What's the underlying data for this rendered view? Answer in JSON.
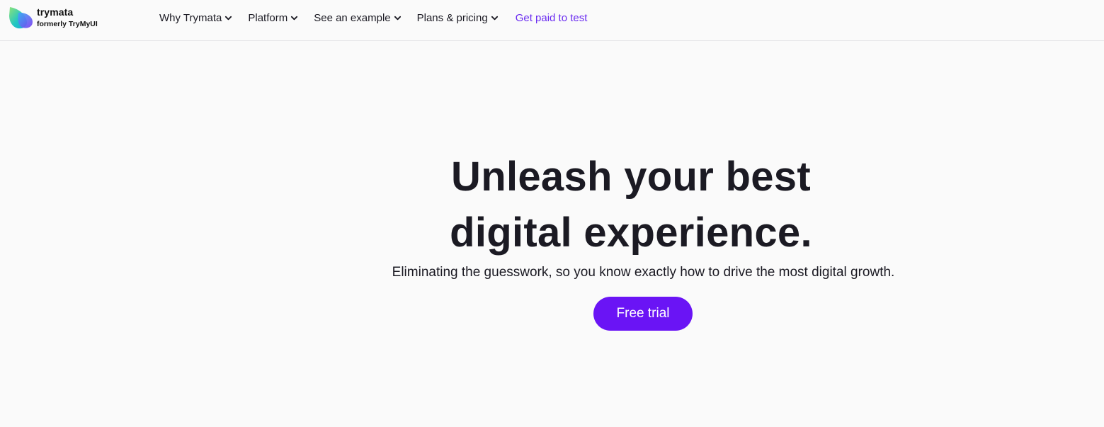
{
  "brand": {
    "name": "trymata",
    "subtitle": "formerly TryMyUI",
    "logo_icon": "leaf-logo-icon",
    "colors": {
      "accent": "#6a14f5",
      "link": "#6a2bf0",
      "logo_green": "#7ee08a",
      "logo_teal": "#1fc4c8",
      "logo_purple": "#7a3cf0"
    }
  },
  "nav": {
    "items": [
      {
        "label": "Why Trymata",
        "icon": "chevron-down-icon"
      },
      {
        "label": "Platform",
        "icon": "chevron-down-icon"
      },
      {
        "label": "See an example",
        "icon": "chevron-down-icon"
      },
      {
        "label": "Plans & pricing",
        "icon": "chevron-down-icon"
      }
    ],
    "cta_link": "Get paid to test"
  },
  "hero": {
    "title_line1": "Unleash your best",
    "title_line2": "digital experience.",
    "subtitle": "Eliminating the guesswork, so you know exactly how to drive the most digital growth.",
    "button_label": "Free trial"
  }
}
